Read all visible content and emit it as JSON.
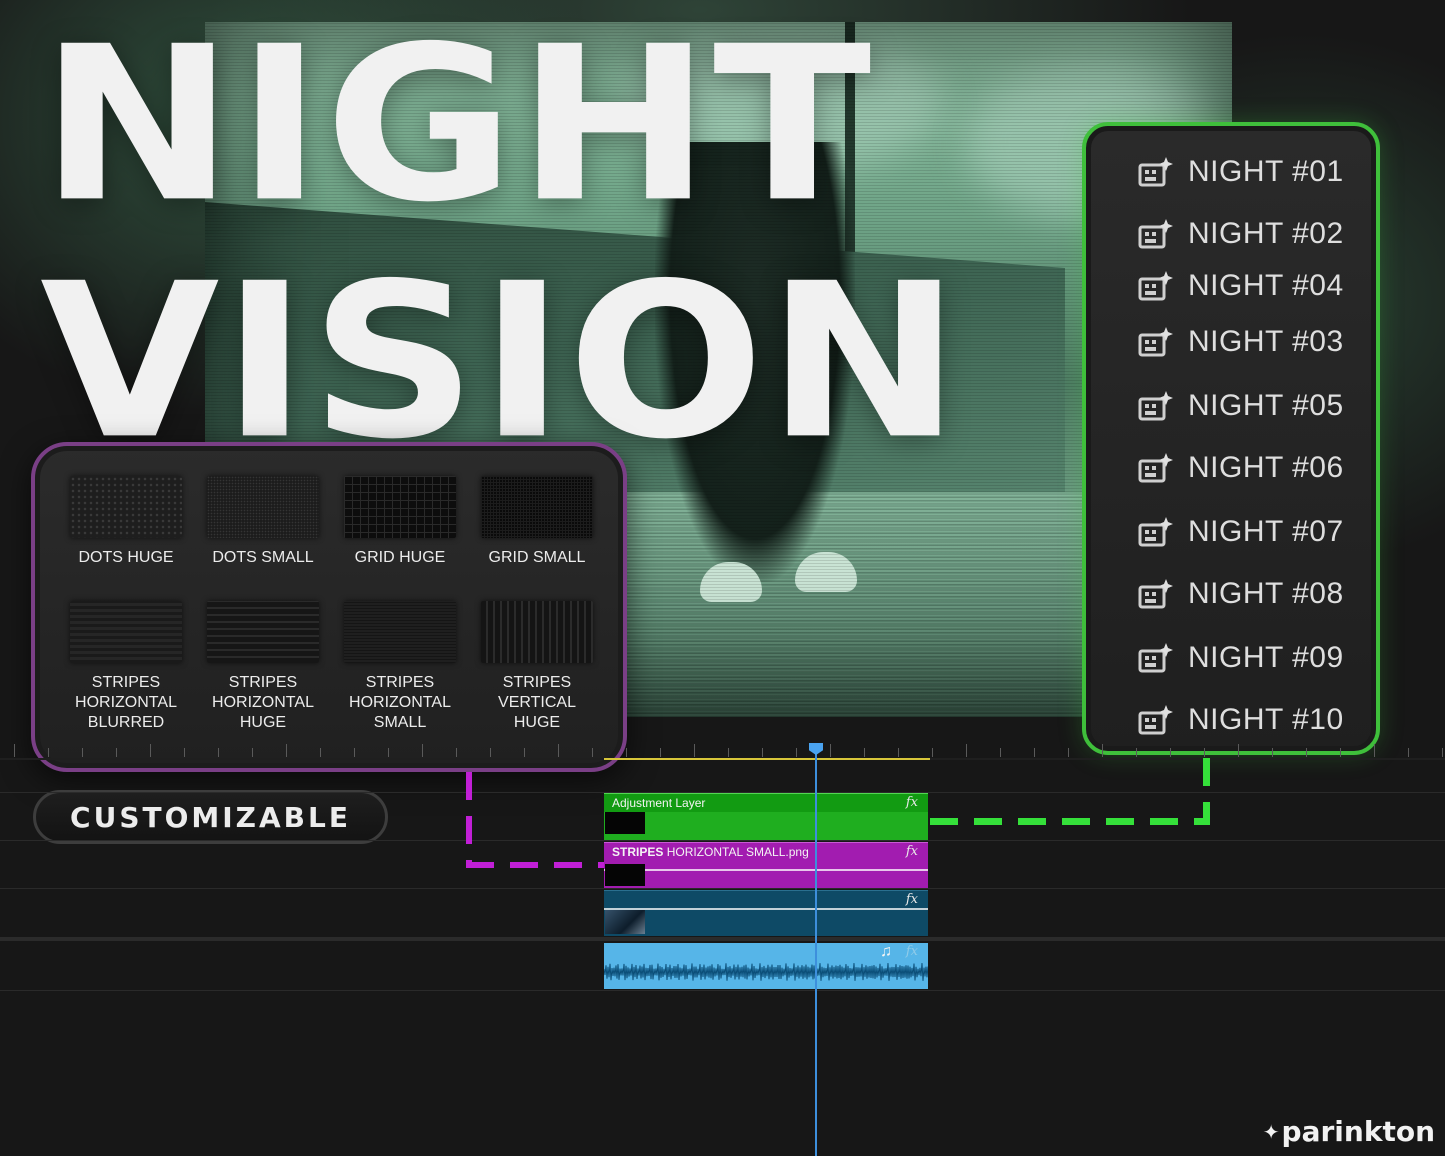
{
  "title": {
    "line1": "NIGHT",
    "line2": "VISION"
  },
  "presets": {
    "accent": "#3fbf3b",
    "icon": "preset-effect-icon",
    "items": [
      {
        "label": "NIGHT #01"
      },
      {
        "label": "NIGHT #02"
      },
      {
        "label": "NIGHT #04"
      },
      {
        "label": "NIGHT #03"
      },
      {
        "label": "NIGHT #05"
      },
      {
        "label": "NIGHT #06"
      },
      {
        "label": "NIGHT #07"
      },
      {
        "label": "NIGHT #08"
      },
      {
        "label": "NIGHT #09"
      },
      {
        "label": "NIGHT #10"
      }
    ]
  },
  "textures": {
    "accent": "#7a3f86",
    "items": [
      {
        "label": "DOTS HUGE"
      },
      {
        "label": "DOTS SMALL"
      },
      {
        "label": "GRID HUGE"
      },
      {
        "label": "GRID SMALL"
      },
      {
        "label": "STRIPES\nHORIZONTAL\nBLURRED"
      },
      {
        "label": "STRIPES\nHORIZONTAL\nHUGE"
      },
      {
        "label": "STRIPES\nHORIZONTAL\nSMALL"
      },
      {
        "label": "STRIPES\nVERTICAL\nHUGE"
      }
    ]
  },
  "badge": {
    "label": "CUSTOMIZABLE"
  },
  "timeline": {
    "clips": {
      "adjustment": {
        "name": "Adjustment Layer",
        "fx": "fx",
        "color": "#1fae1f"
      },
      "texture": {
        "name_bold": "STRIPES",
        "name_rest": " HORIZONTAL SMALL.png",
        "fx": "fx",
        "color": "#a21cb0"
      },
      "video": {
        "fx": "fx",
        "color": "#0e4a66"
      },
      "audio": {
        "note": "♫",
        "fx": "fx",
        "color": "#56b5e8"
      }
    }
  },
  "brand": {
    "name": "parinkton",
    "mark": "✦"
  }
}
